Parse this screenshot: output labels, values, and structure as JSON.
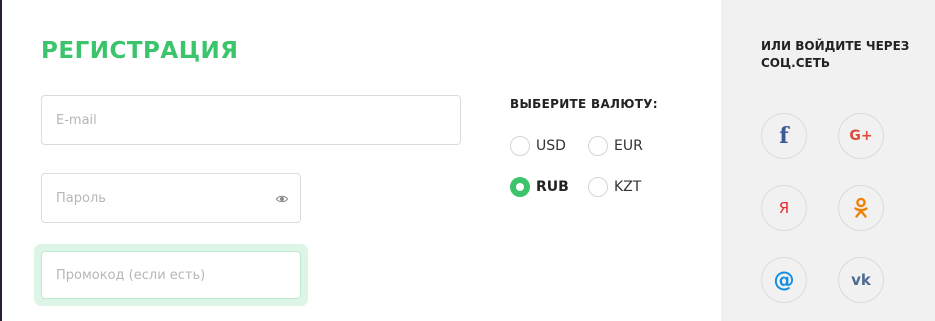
{
  "form": {
    "title": "РЕГИСТРАЦИЯ",
    "email_placeholder": "E-mail",
    "password_placeholder": "Пароль",
    "promo_placeholder": "Промокод (если есть)"
  },
  "currency": {
    "label": "ВЫБЕРИТЕ ВАЛЮТУ:",
    "options": [
      {
        "code": "USD",
        "selected": false
      },
      {
        "code": "EUR",
        "selected": false
      },
      {
        "code": "RUB",
        "selected": true
      },
      {
        "code": "KZT",
        "selected": false
      }
    ]
  },
  "social": {
    "title": "ИЛИ ВОЙДИТЕ ЧЕРЕЗ СОЦ.СЕТЬ",
    "buttons": [
      {
        "icon": "facebook-icon",
        "glyph": "f",
        "color": "#3b5998"
      },
      {
        "icon": "google-plus-icon",
        "glyph": "G+",
        "color": "#dd4b39"
      },
      {
        "icon": "yandex-icon",
        "glyph": "Я",
        "color": "#e62e2e"
      },
      {
        "icon": "odnoklassniki-icon",
        "color": "#ee8208"
      },
      {
        "icon": "mail-ru-icon",
        "glyph": "@",
        "color": "#168de2"
      },
      {
        "icon": "vk-icon",
        "glyph": "vk",
        "color": "#4c6c91"
      }
    ]
  },
  "colors": {
    "accent": "#3cc46d",
    "social_panel_bg": "#f1f1f1"
  }
}
